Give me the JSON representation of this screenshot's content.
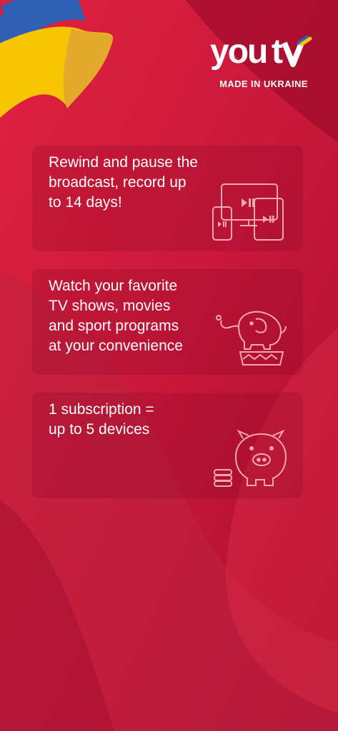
{
  "brand": {
    "logo_text": "youtv",
    "tagline": "MADE IN UKRAINE"
  },
  "colors": {
    "background": "#c2183a",
    "flag_blue": "#2f5fb3",
    "flag_yellow": "#f6c400"
  },
  "features": [
    {
      "text": "Rewind and pause the\nbroadcast, record up\nto 14 days!",
      "icon": "devices-icon"
    },
    {
      "text": "Watch your favorite\nTV shows, movies\nand sport programs\nat your convenience",
      "icon": "circus-elephant-icon"
    },
    {
      "text": "1 subscription =\nup to 5 devices",
      "icon": "piggy-bank-icon"
    }
  ]
}
